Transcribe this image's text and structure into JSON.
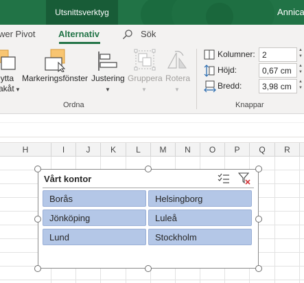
{
  "titlebar": {
    "context_tab": "Utsnittsverktyg",
    "user": "Annica"
  },
  "tabs": {
    "power_pivot": "wer Pivot",
    "alternativ": "Alternativ",
    "search": "Sök"
  },
  "ribbon": {
    "flytta_line1": "lytta",
    "flytta_line2": "akåt",
    "markeringsfonster": "Markeringsfönster",
    "justering": "Justering",
    "gruppera": "Gruppera",
    "rotera": "Rotera",
    "group_ordna": "Ordna",
    "group_knappar": "Knappar",
    "columns_label": "Kolumner:",
    "columns_value": "2",
    "height_label": "Höjd:",
    "height_value": "0,67 cm",
    "width_label": "Bredd:",
    "width_value": "3,98 cm"
  },
  "columns": [
    "H",
    "I",
    "J",
    "K",
    "L",
    "M",
    "N",
    "O",
    "P",
    "Q",
    "R"
  ],
  "slicer": {
    "title": "Vårt kontor",
    "items": [
      "Borås",
      "Helsingborg",
      "Jönköping",
      "Luleå",
      "Lund",
      "Stockholm"
    ],
    "multi_select_icon": "multi-select-icon",
    "clear_filter_icon": "clear-filter-icon",
    "item_color": "#b4c7e7"
  },
  "colors": {
    "accent": "#217346"
  }
}
